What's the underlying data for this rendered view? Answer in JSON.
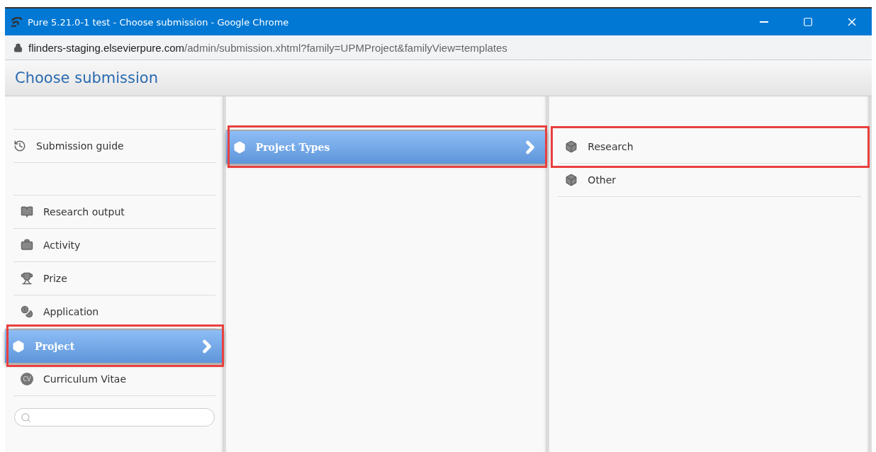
{
  "window": {
    "title": "Pure 5.21.0-1 test - Choose submission - Google Chrome"
  },
  "address_bar": {
    "host": "flinders-staging.elsevierpure.com",
    "path": "/admin/submission.xhtml?family=UPMProject&familyView=templates"
  },
  "page": {
    "title": "Choose submission"
  },
  "sidebar": {
    "guide": {
      "label": "Submission guide",
      "kind": "guide"
    },
    "items": [
      {
        "label": "Research output",
        "kind": "output",
        "selected": false,
        "highlighted": false
      },
      {
        "label": "Activity",
        "kind": "activity",
        "selected": false,
        "highlighted": false
      },
      {
        "label": "Prize",
        "kind": "prize",
        "selected": false,
        "highlighted": false
      },
      {
        "label": "Application",
        "kind": "application",
        "selected": false,
        "highlighted": false
      },
      {
        "label": "Project",
        "kind": "project",
        "selected": true,
        "highlighted": true
      },
      {
        "label": "Curriculum Vitae",
        "kind": "cv",
        "badge": "CV",
        "selected": false,
        "highlighted": false
      }
    ]
  },
  "middle_column": {
    "items": [
      {
        "label": "Project Types",
        "selected": true,
        "highlighted": true
      }
    ]
  },
  "right_column": {
    "items": [
      {
        "label": "Research",
        "selected": false,
        "highlighted": true
      },
      {
        "label": "Other",
        "selected": false,
        "highlighted": false
      }
    ]
  }
}
